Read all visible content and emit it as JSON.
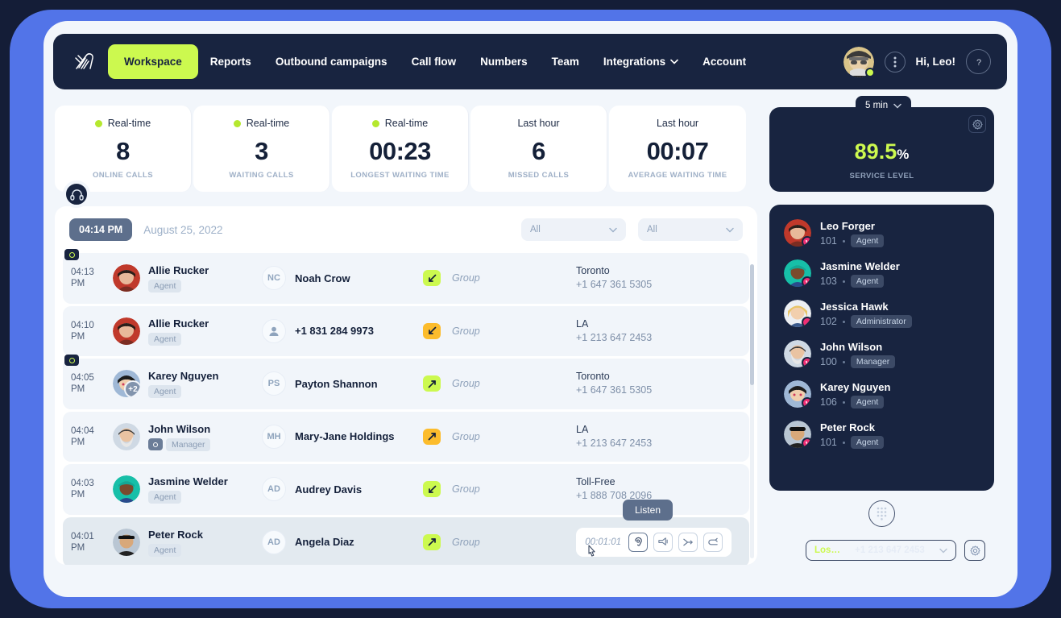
{
  "nav": {
    "logo": "brand-logo",
    "items": [
      {
        "label": "Workspace",
        "active": true,
        "caret": false
      },
      {
        "label": "Reports",
        "active": false,
        "caret": false
      },
      {
        "label": "Outbound campaigns",
        "active": false,
        "caret": false
      },
      {
        "label": "Call flow",
        "active": false,
        "caret": false
      },
      {
        "label": "Numbers",
        "active": false,
        "caret": false
      },
      {
        "label": "Team",
        "active": false,
        "caret": false
      },
      {
        "label": "Integrations",
        "active": false,
        "caret": true
      },
      {
        "label": "Account",
        "active": false,
        "caret": false
      }
    ],
    "greeting": "Hi, Leo!",
    "accent": "#ccf94f",
    "bar_bg": "#182440"
  },
  "stats": [
    {
      "period": "Real-time",
      "realtime": true,
      "value": "8",
      "label": "ONLINE CALLS"
    },
    {
      "period": "Real-time",
      "realtime": true,
      "value": "3",
      "label": "WAITING CALLS"
    },
    {
      "period": "Real-time",
      "realtime": true,
      "value": "00:23",
      "label": "LONGEST WAITING TIME"
    },
    {
      "period": "Last hour",
      "realtime": false,
      "value": "6",
      "label": "MISSED CALLS"
    },
    {
      "period": "Last hour",
      "realtime": false,
      "value": "00:07",
      "label": "AVERAGE WAITING TIME"
    }
  ],
  "service_level": {
    "period_selector": "5 min",
    "value": "89.5",
    "unit": "%",
    "label": "SERVICE LEVEL",
    "value_color": "#ccf94f"
  },
  "panel": {
    "time": "04:14 PM",
    "date": "August 25, 2022",
    "filter_left": "All",
    "filter_right": "All",
    "rows": [
      {
        "time": "04:13\nPM",
        "recording": true,
        "agent": "Allie Rucker",
        "agent_role": "Agent",
        "agent_muted": false,
        "agent_extra": "",
        "contact": "Noah Crow",
        "contact_initials": "NC",
        "contact_is_person_icon": false,
        "direction": "inbound",
        "direction_color": "green",
        "group": "Group",
        "line_name": "Toronto",
        "line_number": "+1 647 361 5305",
        "selected": false
      },
      {
        "time": "04:10\nPM",
        "recording": false,
        "agent": "Allie Rucker",
        "agent_role": "Agent",
        "agent_muted": false,
        "agent_extra": "",
        "contact": "+1 831 284 9973",
        "contact_initials": "",
        "contact_is_person_icon": true,
        "direction": "inbound",
        "direction_color": "amber",
        "group": "Group",
        "line_name": "LA",
        "line_number": "+1 213 647 2453",
        "selected": false
      },
      {
        "time": "04:05\nPM",
        "recording": true,
        "agent": "Karey Nguyen",
        "agent_role": "Agent",
        "agent_muted": false,
        "agent_extra": "+2",
        "contact": "Payton Shannon",
        "contact_initials": "PS",
        "contact_is_person_icon": false,
        "direction": "outbound",
        "direction_color": "green",
        "group": "Group",
        "line_name": "Toronto",
        "line_number": "+1 647 361 5305",
        "selected": false
      },
      {
        "time": "04:04\nPM",
        "recording": false,
        "agent": "John Wilson",
        "agent_role": "Manager",
        "agent_muted": true,
        "agent_extra": "",
        "contact": "Mary-Jane Holdings",
        "contact_initials": "MH",
        "contact_is_person_icon": false,
        "direction": "outbound",
        "direction_color": "amber",
        "group": "Group",
        "line_name": "LA",
        "line_number": "+1 213 647 2453",
        "selected": false
      },
      {
        "time": "04:03\nPM",
        "recording": false,
        "agent": "Jasmine Welder",
        "agent_role": "Agent",
        "agent_muted": false,
        "agent_extra": "",
        "contact": "Audrey Davis",
        "contact_initials": "AD",
        "contact_is_person_icon": false,
        "direction": "inbound",
        "direction_color": "green",
        "group": "Group",
        "line_name": "Toll-Free",
        "line_number": "+1 888 708 2096",
        "selected": false
      },
      {
        "time": "04:01\nPM",
        "recording": false,
        "agent": "Peter Rock",
        "agent_role": "Agent",
        "agent_muted": false,
        "agent_extra": "",
        "contact": "Angela Diaz",
        "contact_initials": "AD",
        "contact_is_person_icon": false,
        "direction": "outbound",
        "direction_color": "green",
        "group": "Group",
        "line_name": "",
        "line_number": "",
        "selected": true
      }
    ],
    "actions": {
      "duration": "00:01:01",
      "tooltip": "Listen",
      "buttons": [
        "listen-icon",
        "whisper-icon",
        "transfer-icon",
        "takeover-icon"
      ]
    }
  },
  "agents_panel": {
    "agents": [
      {
        "name": "Leo Forger",
        "ext": "101",
        "role": "Agent",
        "status": "on-call"
      },
      {
        "name": "Jasmine Welder",
        "ext": "103",
        "role": "Agent",
        "status": "on-call"
      },
      {
        "name": "Jessica Hawk",
        "ext": "102",
        "role": "Administrator",
        "status": "busy"
      },
      {
        "name": "John Wilson",
        "ext": "100",
        "role": "Manager",
        "status": "on-call"
      },
      {
        "name": "Karey Nguyen",
        "ext": "106",
        "role": "Agent",
        "status": "on-call"
      },
      {
        "name": "Peter Rock",
        "ext": "101",
        "role": "Agent",
        "status": "on-call"
      }
    ]
  },
  "dialer": {
    "location": "Los…",
    "number": "+1 213 647 2453"
  },
  "theme": {
    "page_bg": "#141d37",
    "frame_blue": "#5274e8",
    "surface": "#f2f6fb",
    "dark": "#182440",
    "accent": "#ccf94f",
    "amber": "#fcbc2c",
    "pink": "#ef2d73"
  }
}
